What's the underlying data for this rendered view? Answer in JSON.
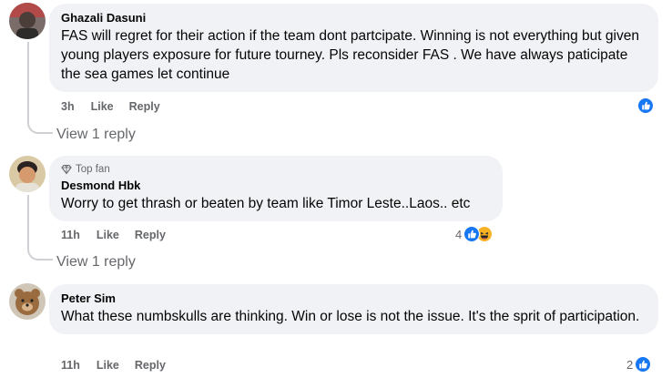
{
  "comments": [
    {
      "author": "Ghazali Dasuni",
      "text": "FAS will regret for their action if the team dont partcipate. Winning is not everything but given young players exposure for future tourney. Pls reconsider FAS . We have always paticipate the sea games let continue",
      "time": "3h",
      "like_label": "Like",
      "reply_label": "Reply",
      "view_replies": "View 1 reply",
      "reaction_count": "",
      "reactions": [
        "like"
      ]
    },
    {
      "badge": "Top fan",
      "author": "Desmond Hbk",
      "text": "Worry to get thrash or beaten by team like Timor Leste..Laos.. etc",
      "time": "11h",
      "like_label": "Like",
      "reply_label": "Reply",
      "view_replies": "View 1 reply",
      "reaction_count": "4",
      "reactions": [
        "like",
        "haha"
      ]
    },
    {
      "author": "Peter Sim",
      "text": "What these numbskulls are thinking. Win or lose is not the issue. It's the sprit of participation.",
      "time": "11h",
      "like_label": "Like",
      "reply_label": "Reply",
      "reaction_count": "2",
      "reactions": [
        "like"
      ]
    }
  ],
  "colors": {
    "bubble": "#f0f2f5",
    "secondary_text": "#65676b",
    "like_blue": "#1877f2",
    "haha_yellow": "#f7b125"
  }
}
